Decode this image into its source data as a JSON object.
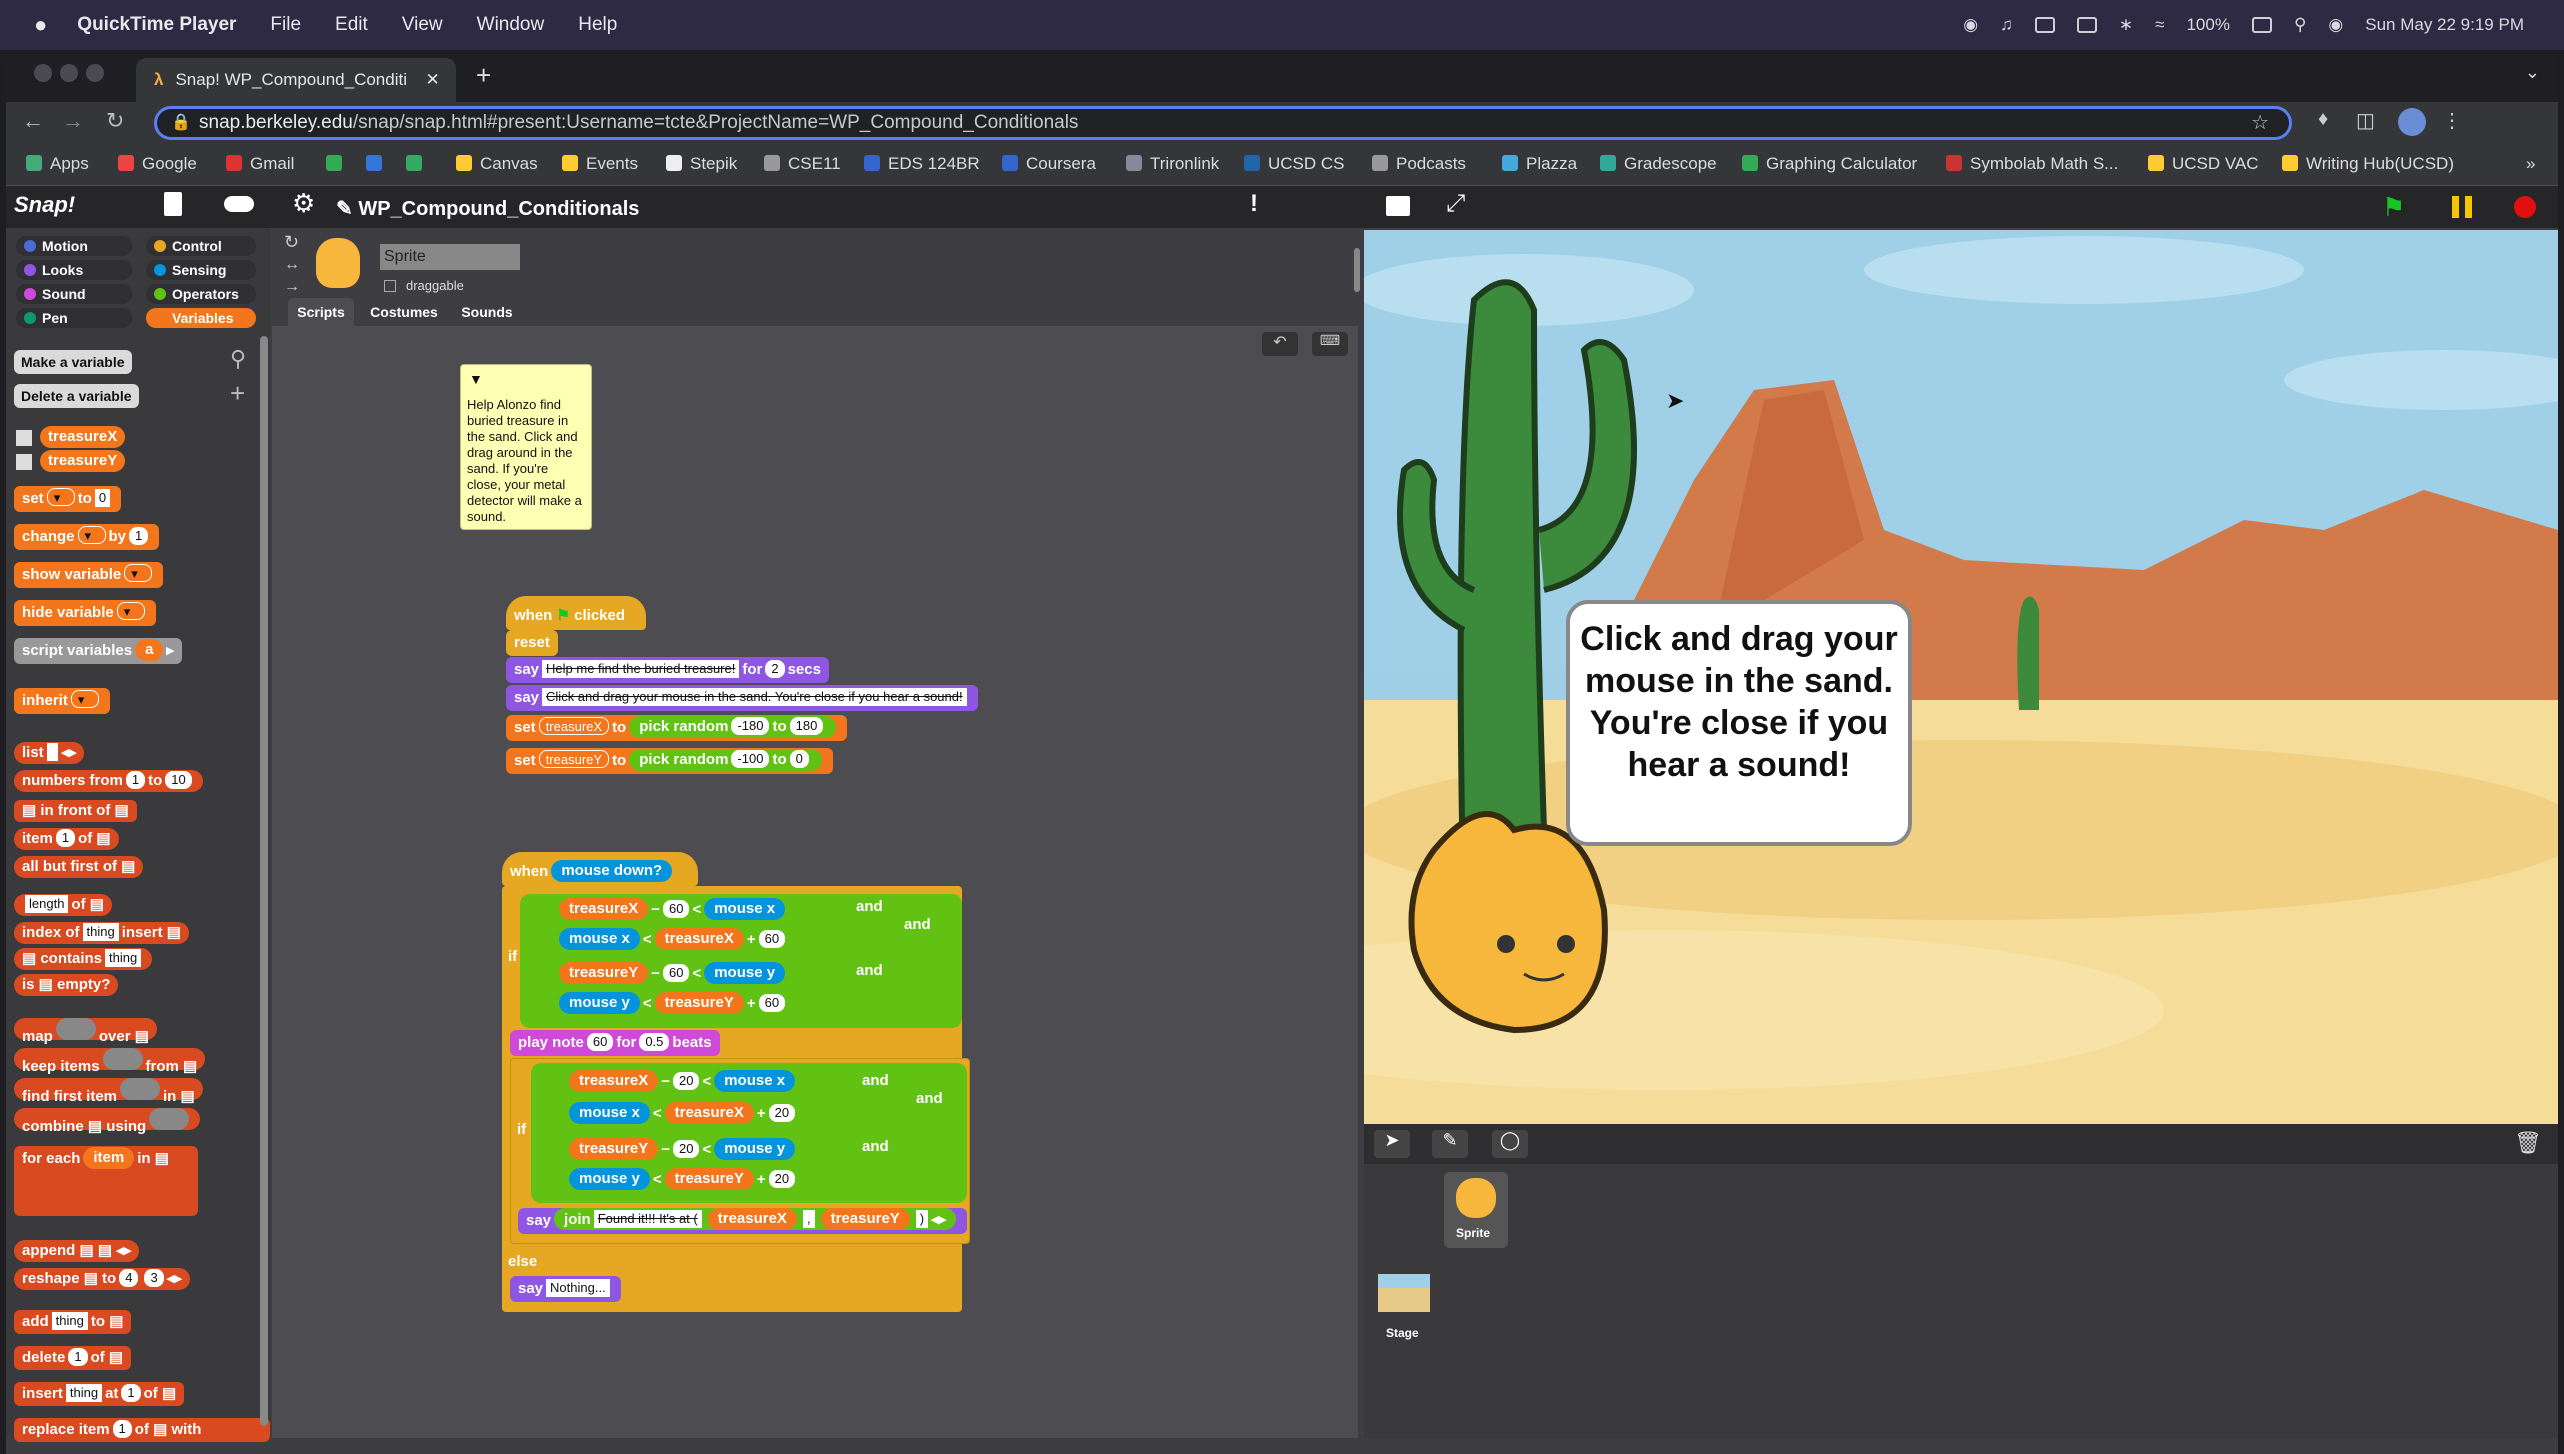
{
  "menubar": {
    "app": "QuickTime Player",
    "items": [
      "File",
      "Edit",
      "View",
      "Window",
      "Help"
    ],
    "battery": "100%",
    "clock": "Sun May 22  9:19 PM"
  },
  "browser": {
    "tab_title": "Snap! WP_Compound_Conditi",
    "url_domain": "snap.berkeley.edu",
    "url_path": "/snap/snap.html#present:Username=tcte&ProjectName=WP_Compound_Conditionals",
    "bookmarks": [
      "Apps",
      "Google",
      "Gmail",
      "Canvas",
      "Events",
      "Stepik",
      "CSE11",
      "EDS 124BR",
      "Coursera",
      "Trironlink",
      "UCSD CS",
      "Podcasts",
      "Plazza",
      "Gradescope",
      "Graphing Calculator",
      "Symbolab Math S...",
      "UCSD VAC",
      "Writing Hub(UCSD)"
    ]
  },
  "snap": {
    "logo": "Snap!",
    "project_name": "WP_Compound_Conditionals",
    "categories": [
      "Motion",
      "Looks",
      "Sound",
      "Pen",
      "Control",
      "Sensing",
      "Operators",
      "Variables"
    ],
    "palette": {
      "make_var": "Make a variable",
      "delete_var": "Delete a variable",
      "vars": [
        "treasureX",
        "treasureY"
      ],
      "blocks": [
        "set",
        "to",
        "change",
        "by",
        "show variable",
        "hide variable",
        "script variables",
        "inherit",
        "list",
        "numbers from",
        "in front of",
        "item",
        "of",
        "all but first of",
        "length",
        "index of",
        "contains",
        "is",
        "empty?",
        "map",
        "over",
        "keep items",
        "from",
        "find first item",
        "in",
        "combine",
        "using",
        "for each",
        "append",
        "reshape",
        "add",
        "delete",
        "insert",
        "at",
        "replace item",
        "with"
      ],
      "slot_values": [
        "0",
        "1",
        "1",
        "10",
        "1",
        "thing",
        "thing",
        "4",
        "3",
        "thing",
        "1",
        "thing",
        "1",
        "1",
        "item",
        "a"
      ]
    },
    "sprite": {
      "name": "Sprite",
      "draggable": "draggable",
      "tabs": [
        "Scripts",
        "Costumes",
        "Sounds"
      ]
    },
    "comment": "Help Alonzo find buried treasure in the sand. Click and drag around in the sand. If you're close, your metal detector will make a sound.",
    "script1": {
      "hat": "when",
      "clicked": "clicked",
      "reset": "reset",
      "say": "say",
      "say1_text": "Help me find the buried treasure!",
      "for": "for",
      "secs_val": "2",
      "secs": "secs",
      "say2_text": "Click and drag your mouse in the sand. You're close if you hear a sound!",
      "set": "set",
      "to": "to",
      "treasureX": "treasureX",
      "treasureY": "treasureY",
      "pick_random": "pick random",
      "r1a": "-180",
      "r1b": "180",
      "r2a": "-100",
      "r2b": "0"
    },
    "script2": {
      "when": "when",
      "mouse_down": "mouse down?",
      "if": "if",
      "else": "else",
      "and": "and",
      "minus": "−",
      "plus": "+",
      "lt": "<",
      "treasureX": "treasureX",
      "treasureY": "treasureY",
      "mouse_x": "mouse x",
      "mouse_y": "mouse y",
      "n60": "60",
      "n20": "20",
      "play_note": "play note",
      "note_val": "60",
      "for": "for",
      "beats_val": "0.5",
      "beats": "beats",
      "say": "say",
      "join": "join",
      "found": "Found it!!! It's at (",
      "comma": ",",
      "close": ")",
      "nothing": "Nothing..."
    },
    "stage_speech": "Click and drag your mouse in the sand. You're close if you hear a sound!",
    "corral": {
      "sprite": "Sprite",
      "stage": "Stage"
    }
  }
}
